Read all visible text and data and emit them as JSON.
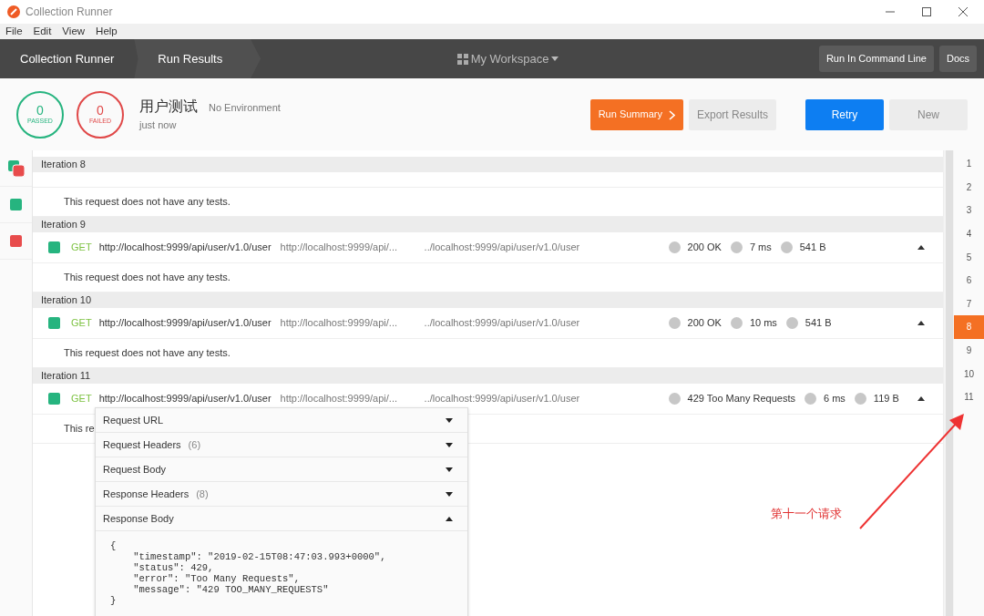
{
  "window": {
    "title": "Collection Runner"
  },
  "menu": [
    "File",
    "Edit",
    "View",
    "Help"
  ],
  "breadcrumbs": [
    {
      "label": "Collection Runner"
    },
    {
      "label": "Run Results"
    }
  ],
  "workspace": "My Workspace",
  "header_buttons": [
    "Run In Command Line",
    "Docs"
  ],
  "summary": {
    "passed": "0",
    "passed_label": "PASSED",
    "failed": "0",
    "failed_label": "FAILED",
    "name": "用户测试",
    "environment": "No Environment",
    "time": "just now"
  },
  "actions": [
    {
      "label": "Run Summary",
      "kind": "orange"
    },
    {
      "label": "Export Results",
      "kind": "light"
    },
    {
      "label": "Retry",
      "kind": "primary"
    },
    {
      "label": "New",
      "kind": "light"
    }
  ],
  "sidebar": [
    {
      "kind": "both"
    },
    {
      "kind": "passed"
    },
    {
      "kind": "failed"
    }
  ],
  "iterations": [
    {
      "title": "Iteration 8",
      "tests": "This request does not have any tests."
    },
    {
      "title": "Iteration 9",
      "method": "GET",
      "url": "http://localhost:9999/api/user/v1.0/user",
      "url_short": "http://localhost:9999/api/...",
      "url_tail": "../localhost:9999/api/user/v1.0/user",
      "status": "200 OK",
      "time": "7 ms",
      "size": "541 B",
      "expanded": true,
      "tests": "This request does not have any tests."
    },
    {
      "title": "Iteration 10",
      "method": "GET",
      "url": "http://localhost:9999/api/user/v1.0/user",
      "url_short": "http://localhost:9999/api/...",
      "url_tail": "../localhost:9999/api/user/v1.0/user",
      "status": "200 OK",
      "time": "10 ms",
      "size": "541 B",
      "expanded": true,
      "tests": "This request does not have any tests."
    },
    {
      "title": "Iteration 11",
      "method": "GET",
      "url": "http://localhost:9999/api/user/v1.0/user",
      "url_short": "http://localhost:9999/api/...",
      "url_tail": "../localhost:9999/api/user/v1.0/user",
      "status": "429 Too Many Requests",
      "time": "6 ms",
      "size": "119 B",
      "expanded": true,
      "tests": "This re"
    }
  ],
  "details": [
    {
      "label": "Request URL",
      "expanded": false
    },
    {
      "label": "Request Headers",
      "count": "(6)",
      "expanded": false
    },
    {
      "label": "Request Body",
      "expanded": false
    },
    {
      "label": "Response Headers",
      "count": "(8)",
      "expanded": false
    },
    {
      "label": "Response Body",
      "expanded": true
    }
  ],
  "response_body": [
    "{",
    "    \"timestamp\": \"2019-02-15T08:47:03.993+0000\",",
    "    \"status\": 429,",
    "    \"error\": \"Too Many Requests\",",
    "    \"message\": \"429 TOO_MANY_REQUESTS\"",
    "}"
  ],
  "iteration_nav": [
    {
      "label": "1",
      "selected": false
    },
    {
      "label": "2",
      "selected": false
    },
    {
      "label": "3",
      "selected": false
    },
    {
      "label": "4",
      "selected": false
    },
    {
      "label": "5",
      "selected": false
    },
    {
      "label": "6",
      "selected": false
    },
    {
      "label": "7",
      "selected": false
    },
    {
      "label": "8",
      "selected": true
    },
    {
      "label": "9",
      "selected": false
    },
    {
      "label": "10",
      "selected": false
    },
    {
      "label": "11",
      "selected": false
    }
  ],
  "annotation": {
    "text": "第十一个请求"
  }
}
